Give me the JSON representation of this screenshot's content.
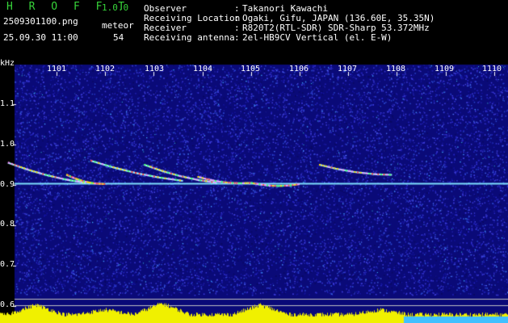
{
  "header": {
    "app_title": "HROFFT",
    "app_version": "1.0.0",
    "file_name": "2509301100.png",
    "timestamp": "25.09.30 11:00",
    "mode_label": "meteor",
    "count_value": "54"
  },
  "station_info": [
    {
      "key": "Observer",
      "value": "Takanori Kawachi"
    },
    {
      "key": "Receiving Location",
      "value": "Ogaki, Gifu, JAPAN (136.60E, 35.35N)"
    },
    {
      "key": "Receiver",
      "value": "R820T2(RTL-SDR) SDR-Sharp 53.372MHz"
    },
    {
      "key": "Receiving antenna",
      "value": "2el-HB9CV Vertical (el. E-W)"
    }
  ],
  "frequency_axis": {
    "unit_label": "kHz",
    "ticks": [
      "1.1",
      "1.0",
      "0.9",
      "0.8",
      "0.7",
      "0.6"
    ]
  },
  "time_axis": {
    "ticks": [
      "1101",
      "1102",
      "1103",
      "1104",
      "1105",
      "1106",
      "1107",
      "1108",
      "1109",
      "1110"
    ]
  },
  "colors": {
    "background": "#0a0a78",
    "header_text": "#37d43a",
    "info_text": "#ffffff",
    "signal_line": "#9ff6ff",
    "level_bar": "#f0f000"
  },
  "echoes": [
    {
      "start_min": 1100.0,
      "end_min": 1101.6,
      "start_khz": 0.955,
      "end_khz": 0.905
    },
    {
      "start_min": 1101.2,
      "end_min": 1102.0,
      "start_khz": 0.925,
      "end_khz": 0.902
    },
    {
      "start_min": 1101.7,
      "end_min": 1103.6,
      "start_khz": 0.96,
      "end_khz": 0.91
    },
    {
      "start_min": 1102.8,
      "end_min": 1104.3,
      "start_khz": 0.95,
      "end_khz": 0.905
    },
    {
      "start_min": 1103.9,
      "end_min": 1105.0,
      "start_khz": 0.92,
      "end_khz": 0.905
    },
    {
      "start_min": 1106.4,
      "end_min": 1107.9,
      "start_khz": 0.95,
      "end_khz": 0.925
    },
    {
      "start_min": 1105.0,
      "end_min": 1106.0,
      "start_khz": 0.905,
      "end_khz": 0.902
    }
  ],
  "carrier_khz": 0.903
}
